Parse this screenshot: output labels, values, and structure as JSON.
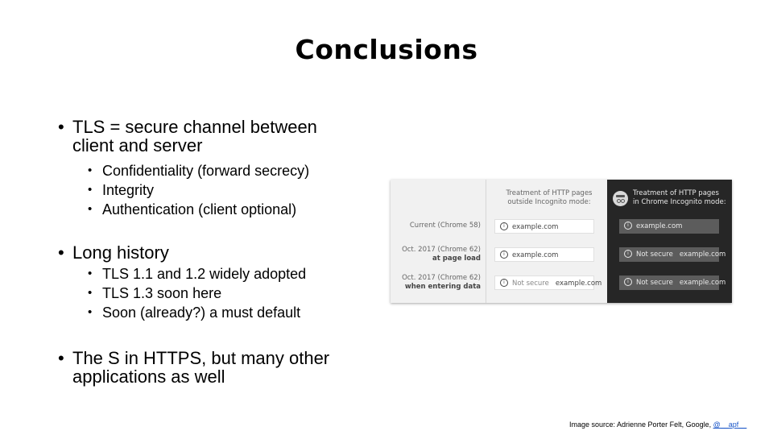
{
  "slide": {
    "title": "Conclusions",
    "bullets": [
      {
        "text": "TLS = secure channel between client and server",
        "line1": "TLS = secure channel between",
        "line2": "client and server",
        "sub": [
          "Confidentiality (forward secrecy)",
          "Integrity",
          "Authentication (client optional)"
        ]
      },
      {
        "text": "Long history",
        "sub": [
          "TLS 1.1 and 1.2 widely adopted",
          "TLS 1.3 soon here",
          "Soon (already?) a must default"
        ]
      },
      {
        "text": "The S in HTTPS, but many other applications as well",
        "line1": "The S in HTTPS, but many other",
        "line2": "applications as well"
      }
    ],
    "source": {
      "prefix": "Image source: Adrienne Porter Felt, Google, ",
      "link": "@__apf__"
    }
  },
  "figure": {
    "header_light": [
      "Treatment of HTTP pages",
      "outside Incognito mode:"
    ],
    "header_dark": [
      "Treatment of HTTP pages",
      "in Chrome Incognito mode:"
    ],
    "icon": "incognito-icon",
    "rows": [
      {
        "label": "Current (Chrome 58)",
        "sublabel": "",
        "light": {
          "warning": "",
          "url": "example.com"
        },
        "dark": {
          "warning": "",
          "url": "example.com"
        }
      },
      {
        "label": "Oct. 2017 (Chrome 62)",
        "sublabel": "at page load",
        "light": {
          "warning": "",
          "url": "example.com"
        },
        "dark": {
          "warning": "Not secure",
          "url": "example.com"
        }
      },
      {
        "label": "Oct. 2017 (Chrome 62)",
        "sublabel": "when entering data",
        "light": {
          "warning": "Not secure",
          "url": "example.com"
        },
        "dark": {
          "warning": "Not secure",
          "url": "example.com"
        }
      }
    ],
    "info_glyph": "i"
  }
}
